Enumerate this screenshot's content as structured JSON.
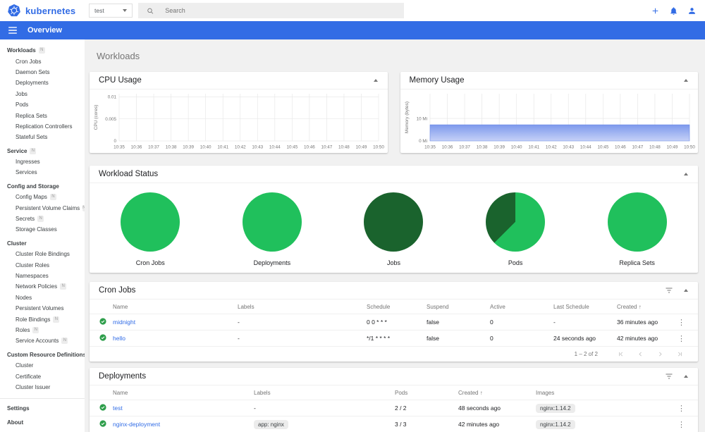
{
  "colors": {
    "brand": "#326ce5",
    "link": "#326de6",
    "status_ok": "#2e9e4b",
    "pie_green": "#20c05c",
    "pie_dark_green": "#1a632d",
    "area_top": "#7d99ec",
    "area_bottom": "#c6d1f7"
  },
  "icons": {
    "sort_up": "↑",
    "kebab": "⋮"
  },
  "header": {
    "brand": "kubernetes",
    "namespace": {
      "value": "test"
    },
    "search_placeholder": "Search"
  },
  "appbar": {
    "title": "Overview"
  },
  "page": {
    "title": "Workloads"
  },
  "sidebar": {
    "badge_letter": "N",
    "sections": [
      {
        "header": "Workloads",
        "badge": true,
        "items": [
          {
            "label": "Cron Jobs"
          },
          {
            "label": "Daemon Sets"
          },
          {
            "label": "Deployments"
          },
          {
            "label": "Jobs"
          },
          {
            "label": "Pods"
          },
          {
            "label": "Replica Sets"
          },
          {
            "label": "Replication Controllers"
          },
          {
            "label": "Stateful Sets"
          }
        ]
      },
      {
        "header": "Service",
        "badge": true,
        "items": [
          {
            "label": "Ingresses"
          },
          {
            "label": "Services"
          }
        ]
      },
      {
        "header": "Config and Storage",
        "badge": false,
        "items": [
          {
            "label": "Config Maps",
            "badge": true
          },
          {
            "label": "Persistent Volume Claims",
            "badge": true
          },
          {
            "label": "Secrets",
            "badge": true
          },
          {
            "label": "Storage Classes"
          }
        ]
      },
      {
        "header": "Cluster",
        "badge": false,
        "items": [
          {
            "label": "Cluster Role Bindings"
          },
          {
            "label": "Cluster Roles"
          },
          {
            "label": "Namespaces"
          },
          {
            "label": "Network Policies",
            "badge": true
          },
          {
            "label": "Nodes"
          },
          {
            "label": "Persistent Volumes"
          },
          {
            "label": "Role Bindings",
            "badge": true
          },
          {
            "label": "Roles",
            "badge": true
          },
          {
            "label": "Service Accounts",
            "badge": true
          }
        ]
      },
      {
        "header": "Custom Resource Definitions",
        "badge": false,
        "items": [
          {
            "label": "Cluster"
          },
          {
            "label": "Certificate"
          },
          {
            "label": "Cluster Issuer"
          }
        ]
      }
    ],
    "footer_items": [
      "Settings",
      "About"
    ]
  },
  "chart_data": [
    {
      "type": "line",
      "title": "CPU Usage",
      "ylabel": "CPU (cores)",
      "ymax": 0.0107,
      "yticks": [
        {
          "value": 0,
          "label": "0"
        },
        {
          "value": 0.005,
          "label": "0.005"
        },
        {
          "value": 0.01,
          "label": "0.01"
        }
      ],
      "x": [
        "10:35",
        "10:36",
        "10:37",
        "10:38",
        "10:39",
        "10:40",
        "10:41",
        "10:42",
        "10:43",
        "10:44",
        "10:45",
        "10:46",
        "10:47",
        "10:48",
        "10:49",
        "10:50"
      ],
      "series": []
    },
    {
      "type": "area",
      "title": "Memory Usage",
      "ylabel": "Memory (bytes)",
      "unit": "Mi",
      "ymax": 21,
      "yticks": [
        {
          "value": 0,
          "label": "0 Mi"
        },
        {
          "value": 10,
          "label": "10 Mi"
        }
      ],
      "x": [
        "10:35",
        "10:36",
        "10:37",
        "10:38",
        "10:39",
        "10:40",
        "10:41",
        "10:42",
        "10:43",
        "10:44",
        "10:45",
        "10:46",
        "10:47",
        "10:48",
        "10:49",
        "10:50"
      ],
      "series": [
        {
          "name": "memory usage",
          "values": [
            7.2,
            7.2,
            7.2,
            7.2,
            7.2,
            7.2,
            7.2,
            7.2,
            7.2,
            7.2,
            7.2,
            7.2,
            7.2,
            7.2,
            7.2,
            7.2
          ]
        }
      ]
    }
  ],
  "workload_status": {
    "title": "Workload Status",
    "pies": [
      {
        "label": "Cron Jobs",
        "slices": [
          {
            "color": "#20c05c",
            "pct": 100
          }
        ]
      },
      {
        "label": "Deployments",
        "slices": [
          {
            "color": "#20c05c",
            "pct": 100
          }
        ]
      },
      {
        "label": "Jobs",
        "slices": [
          {
            "color": "#1a632d",
            "pct": 100
          }
        ]
      },
      {
        "label": "Pods",
        "slices": [
          {
            "color": "#20c05c",
            "pct": 62.5
          },
          {
            "color": "#1a632d",
            "pct": 37.5
          }
        ]
      },
      {
        "label": "Replica Sets",
        "slices": [
          {
            "color": "#20c05c",
            "pct": 100
          }
        ]
      }
    ]
  },
  "cron_jobs": {
    "title": "Cron Jobs",
    "columns": [
      "Name",
      "Labels",
      "Schedule",
      "Suspend",
      "Active",
      "Last Schedule",
      "Created"
    ],
    "sorted_by": "Created",
    "rows": [
      {
        "status": "ok",
        "name": "midnight",
        "labels": "-",
        "schedule": "0 0 * * *",
        "suspend": "false",
        "active": "0",
        "last_schedule": "-",
        "created": "36 minutes ago"
      },
      {
        "status": "ok",
        "name": "hello",
        "labels": "-",
        "schedule": "*/1 * * * *",
        "suspend": "false",
        "active": "0",
        "last_schedule": "24 seconds ago",
        "created": "42 minutes ago"
      }
    ],
    "pagination": {
      "range_label": "1 – 2 of 2"
    }
  },
  "deployments": {
    "title": "Deployments",
    "columns": [
      "Name",
      "Labels",
      "Pods",
      "Created",
      "Images"
    ],
    "sorted_by": "Created",
    "rows": [
      {
        "status": "ok",
        "name": "test",
        "labels": {
          "text": "-",
          "chip": false
        },
        "pods": "2 / 2",
        "created": "48 seconds ago",
        "images": [
          "nginx:1.14.2"
        ]
      },
      {
        "status": "ok",
        "name": "nginx-deployment",
        "labels": {
          "text": "app: nginx",
          "chip": true
        },
        "pods": "3 / 3",
        "created": "42 minutes ago",
        "images": [
          "nginx:1.14.2"
        ]
      }
    ]
  }
}
